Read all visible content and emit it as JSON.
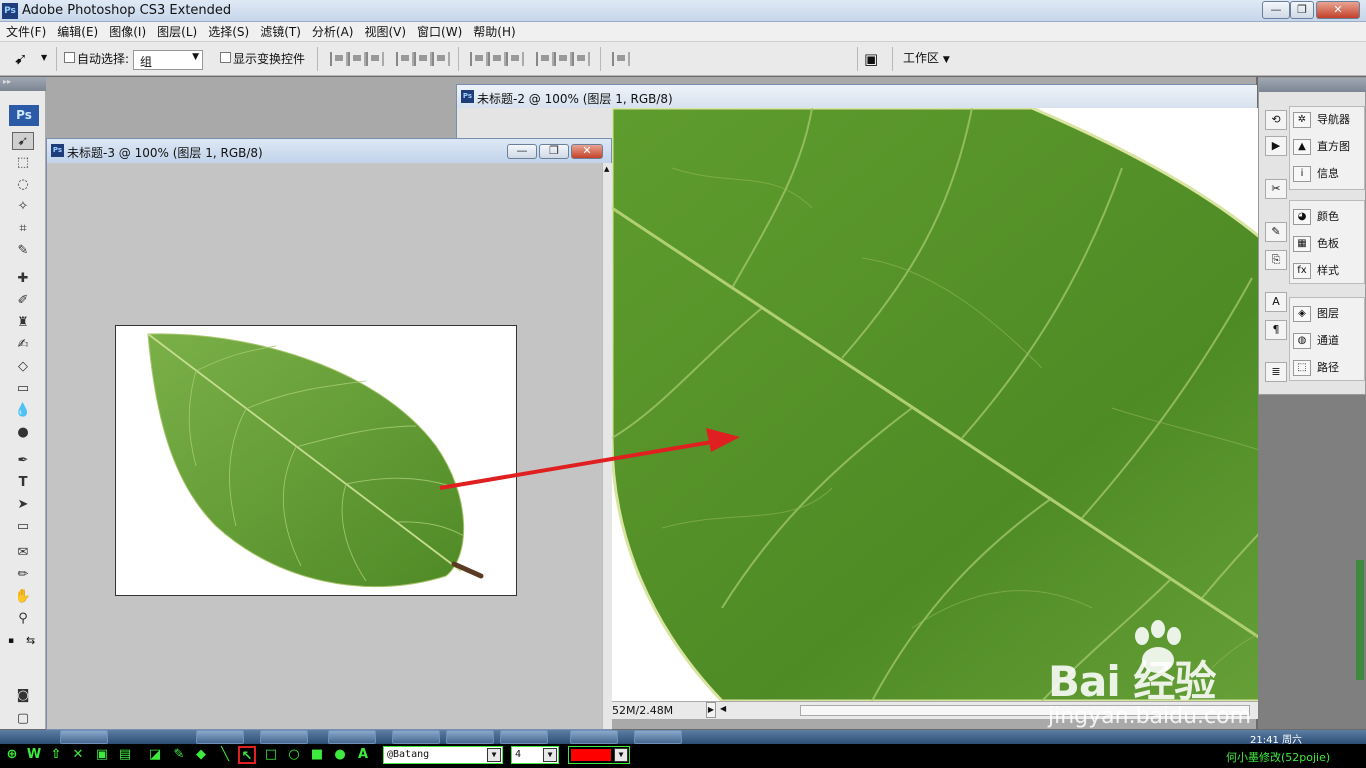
{
  "app": {
    "title": "Adobe Photoshop CS3 Extended",
    "logo_text": "Ps"
  },
  "window_controls": {
    "minimize": "—",
    "restore": "❐",
    "close": "✕"
  },
  "menu": [
    "文件(F)",
    "编辑(E)",
    "图像(I)",
    "图层(L)",
    "选择(S)",
    "滤镜(T)",
    "分析(A)",
    "视图(V)",
    "窗口(W)",
    "帮助(H)"
  ],
  "options": {
    "auto_select_label": "自动选择:",
    "auto_select_value": "组",
    "show_transform_label": "显示变换控件",
    "workspace_label": "工作区"
  },
  "toolbox": {
    "badge": "Ps"
  },
  "documents": {
    "doc3_title": "未标题-3 @ 100% (图层 1, RGB/8)",
    "doc2_title": "未标题-2 @ 100% (图层 1, RGB/8)",
    "doc2_status": "52M/2.48M"
  },
  "panels": {
    "group1": [
      "导航器",
      "直方图",
      "信息"
    ],
    "group2": [
      "颜色",
      "色板",
      "样式"
    ],
    "group3": [
      "图层",
      "通道",
      "路径"
    ]
  },
  "taskbar": {
    "clock": "21:41 周六"
  },
  "capture_toolbar": {
    "font_value": "@Batang",
    "size_value": "4",
    "color": "#ff0000",
    "caption": "何小墨修改(52pojie)"
  },
  "watermark": {
    "brand": "Bai  经验",
    "url": "jingyan.baidu.com"
  }
}
